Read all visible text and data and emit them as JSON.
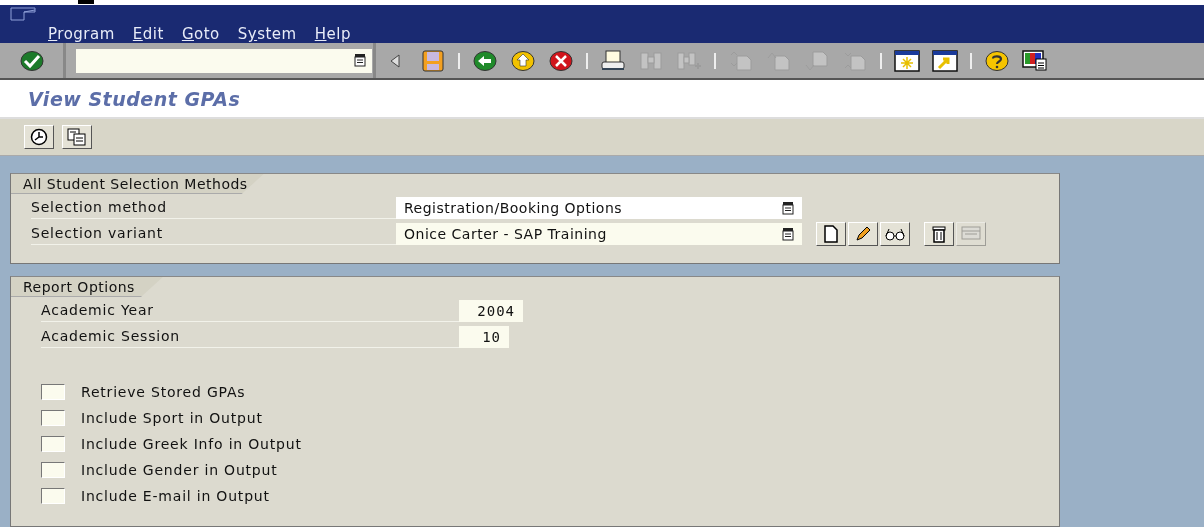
{
  "menu": [
    {
      "label": "Program"
    },
    {
      "label": "Edit"
    },
    {
      "label": "Goto"
    },
    {
      "label": "System"
    },
    {
      "label": "Help"
    }
  ],
  "toolbar": {
    "buttons": [
      {
        "disabled": false
      },
      {
        "disabled": false
      },
      {
        "disabled": false
      },
      {
        "disabled": false
      },
      {
        "disabled": false
      },
      {
        "disabled": false
      },
      {
        "disabled": true
      },
      {
        "disabled": true
      },
      {
        "disabled": true
      },
      {
        "disabled": true
      },
      {
        "disabled": true
      },
      {
        "disabled": true
      },
      {
        "disabled": false
      },
      {
        "disabled": false
      },
      {
        "disabled": false
      },
      {
        "disabled": false
      }
    ]
  },
  "title": "View Student GPAs",
  "selection_group": {
    "title": "All Student Selection Methods",
    "fields": [
      {
        "label": "Selection method",
        "value": "Registration/Booking Options"
      },
      {
        "label": "Selection variant",
        "value": "Onice Carter - SAP Training"
      }
    ],
    "variant_buttons": [
      {
        "disabled": false
      },
      {
        "disabled": false
      },
      {
        "disabled": false
      },
      {
        "disabled": false
      },
      {
        "disabled": true
      }
    ]
  },
  "report_options": {
    "title": "Report Options",
    "fields": [
      {
        "label": "Academic Year",
        "value": "2004"
      },
      {
        "label": "Academic Session",
        "value": "10"
      }
    ],
    "checkboxes": [
      {
        "label": "Retrieve Stored GPAs",
        "checked": false
      },
      {
        "label": "Include Sport in Output",
        "checked": false
      },
      {
        "label": "Include Greek Info in Output",
        "checked": false
      },
      {
        "label": "Include Gender in Output",
        "checked": false
      },
      {
        "label": "Include E-mail in Output",
        "checked": false
      }
    ]
  }
}
